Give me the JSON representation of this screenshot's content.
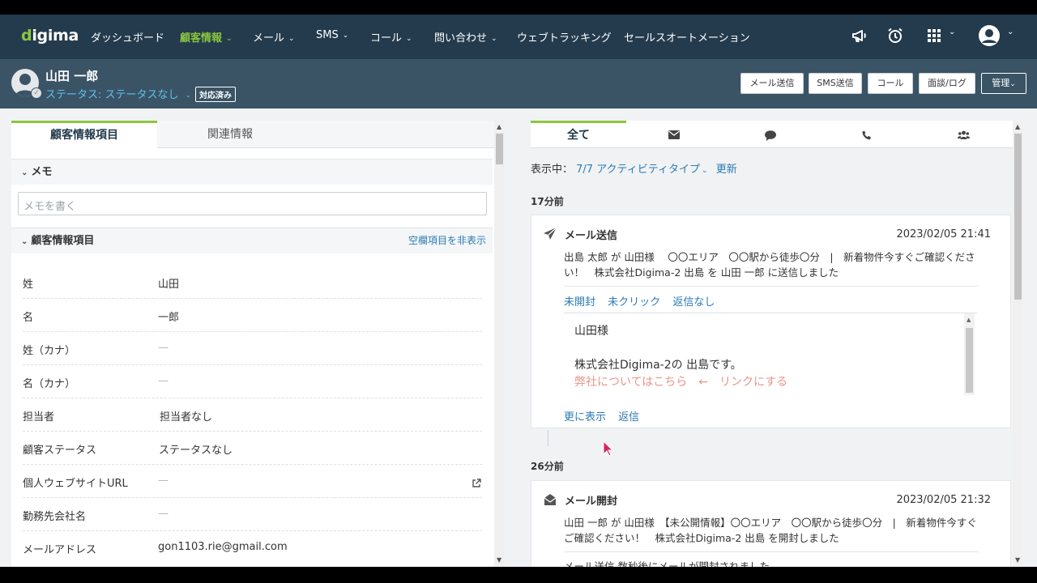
{
  "nav": {
    "logo": "digima",
    "items": [
      {
        "label": "ダッシュボード",
        "caret": false,
        "active": false
      },
      {
        "label": "顧客情報",
        "caret": true,
        "active": true
      },
      {
        "label": "メール",
        "caret": true,
        "active": false
      },
      {
        "label": "SMS",
        "caret": true,
        "active": false
      },
      {
        "label": "コール",
        "caret": true,
        "active": false
      },
      {
        "label": "問い合わせ",
        "caret": true,
        "active": false
      },
      {
        "label": "ウェブトラッキング",
        "caret": false,
        "active": false
      },
      {
        "label": "セールスオートメーション",
        "caret": false,
        "active": false
      }
    ],
    "icons": [
      "megaphone-icon",
      "alarm-clock-icon",
      "apps-grid-icon",
      "user-avatar-icon"
    ]
  },
  "customer": {
    "name": "山田 一郎",
    "status": "ステータス: ステータスなし",
    "status_tag": "対応済み"
  },
  "actions": {
    "send_mail": "メール送信",
    "send_sms": "SMS送信",
    "call": "コール",
    "meeting_log": "面談/ログ",
    "manage": "管理"
  },
  "left": {
    "tabs": [
      "顧客情報項目",
      "関連情報"
    ],
    "memo_title": "メモ",
    "memo_placeholder": "メモを書く",
    "info_title": "顧客情報項目",
    "hide_empty": "空欄項目を非表示",
    "fields": [
      {
        "label": "姓",
        "value": "山田"
      },
      {
        "label": "名",
        "value": "一郎"
      },
      {
        "label": "姓（カナ）",
        "value": "—"
      },
      {
        "label": "名（カナ）",
        "value": "—"
      },
      {
        "label": "担当者",
        "value": "担当者なし"
      },
      {
        "label": "顧客ステータス",
        "value": "ステータスなし"
      },
      {
        "label": "個人ウェブサイトURL",
        "value": "—"
      },
      {
        "label": "勤務先会社名",
        "value": "—"
      },
      {
        "label": "メールアドレス",
        "value": "gon1103.rie@gmail.com"
      }
    ]
  },
  "right": {
    "tabs": [
      "全て",
      "mail-icon",
      "chat-icon",
      "phone-icon",
      "group-icon"
    ],
    "filter_prefix": "表示中：",
    "filter_value": "7/7 アクティビティタイプ",
    "refresh": "更新",
    "groups": [
      {
        "time": "17分前",
        "card": {
          "type": "メール送信",
          "date": "2023/02/05 21:41",
          "text": "出島 太郎 が 山田様　 〇〇エリア　〇〇駅から徒歩〇分　|　新着物件今すぐご確認ください！　株式会社Digima-2 出島 を 山田 一郎 に送信しました",
          "stats": [
            "未開封",
            "未クリック",
            "返信なし"
          ],
          "body": [
            "山田様",
            "株式会社Digima-2の 出島です。",
            "弊社についてはこちら　←　リンクにする"
          ],
          "links": [
            "更に表示",
            "返信"
          ]
        }
      },
      {
        "time": "26分前",
        "card": {
          "type": "メール開封",
          "date": "2023/02/05 21:32",
          "text": "山田 一郎 が 山田様　【未公開情報】〇〇エリア　〇〇駅から徒歩〇分　|　新着物件今すぐご確認ください！　株式会社Digima-2 出島 を開封しました",
          "note": "メール送信 数秒後にメールが開封されました"
        }
      }
    ]
  }
}
